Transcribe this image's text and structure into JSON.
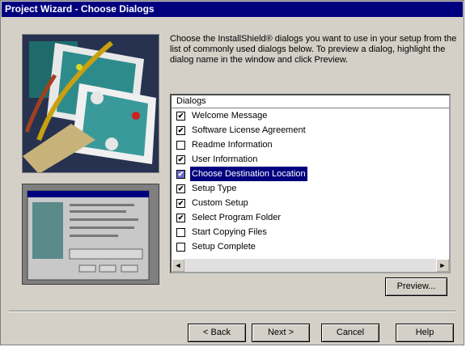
{
  "window": {
    "title": "Project Wizard - Choose Dialogs"
  },
  "intro_text": "Choose the InstallShield® dialogs you want to use in your setup from the list of commonly used dialogs below. To preview a dialog, highlight the dialog name in the window and click Preview.",
  "list": {
    "header": "Dialogs",
    "items": [
      {
        "label": "Welcome Message",
        "checked": true
      },
      {
        "label": "Software License Agreement",
        "checked": true
      },
      {
        "label": "Readme Information",
        "checked": false
      },
      {
        "label": "User Information",
        "checked": true
      },
      {
        "label": "Choose Destination Location",
        "checked": true,
        "selected": true
      },
      {
        "label": "Setup Type",
        "checked": true
      },
      {
        "label": "Custom Setup",
        "checked": true
      },
      {
        "label": "Select Program Folder",
        "checked": true
      },
      {
        "label": "Start Copying Files",
        "checked": false
      },
      {
        "label": "Setup Complete",
        "checked": false
      }
    ]
  },
  "buttons": {
    "preview": "Preview...",
    "back": "< Back",
    "next": "Next >",
    "cancel": "Cancel",
    "help": "Help"
  },
  "colors": {
    "title_bar": "#00007f",
    "face": "#d4d0c8",
    "selection": "#00007f"
  },
  "icons": {
    "scroll_left": "◄",
    "scroll_right": "►",
    "check": "✔"
  }
}
